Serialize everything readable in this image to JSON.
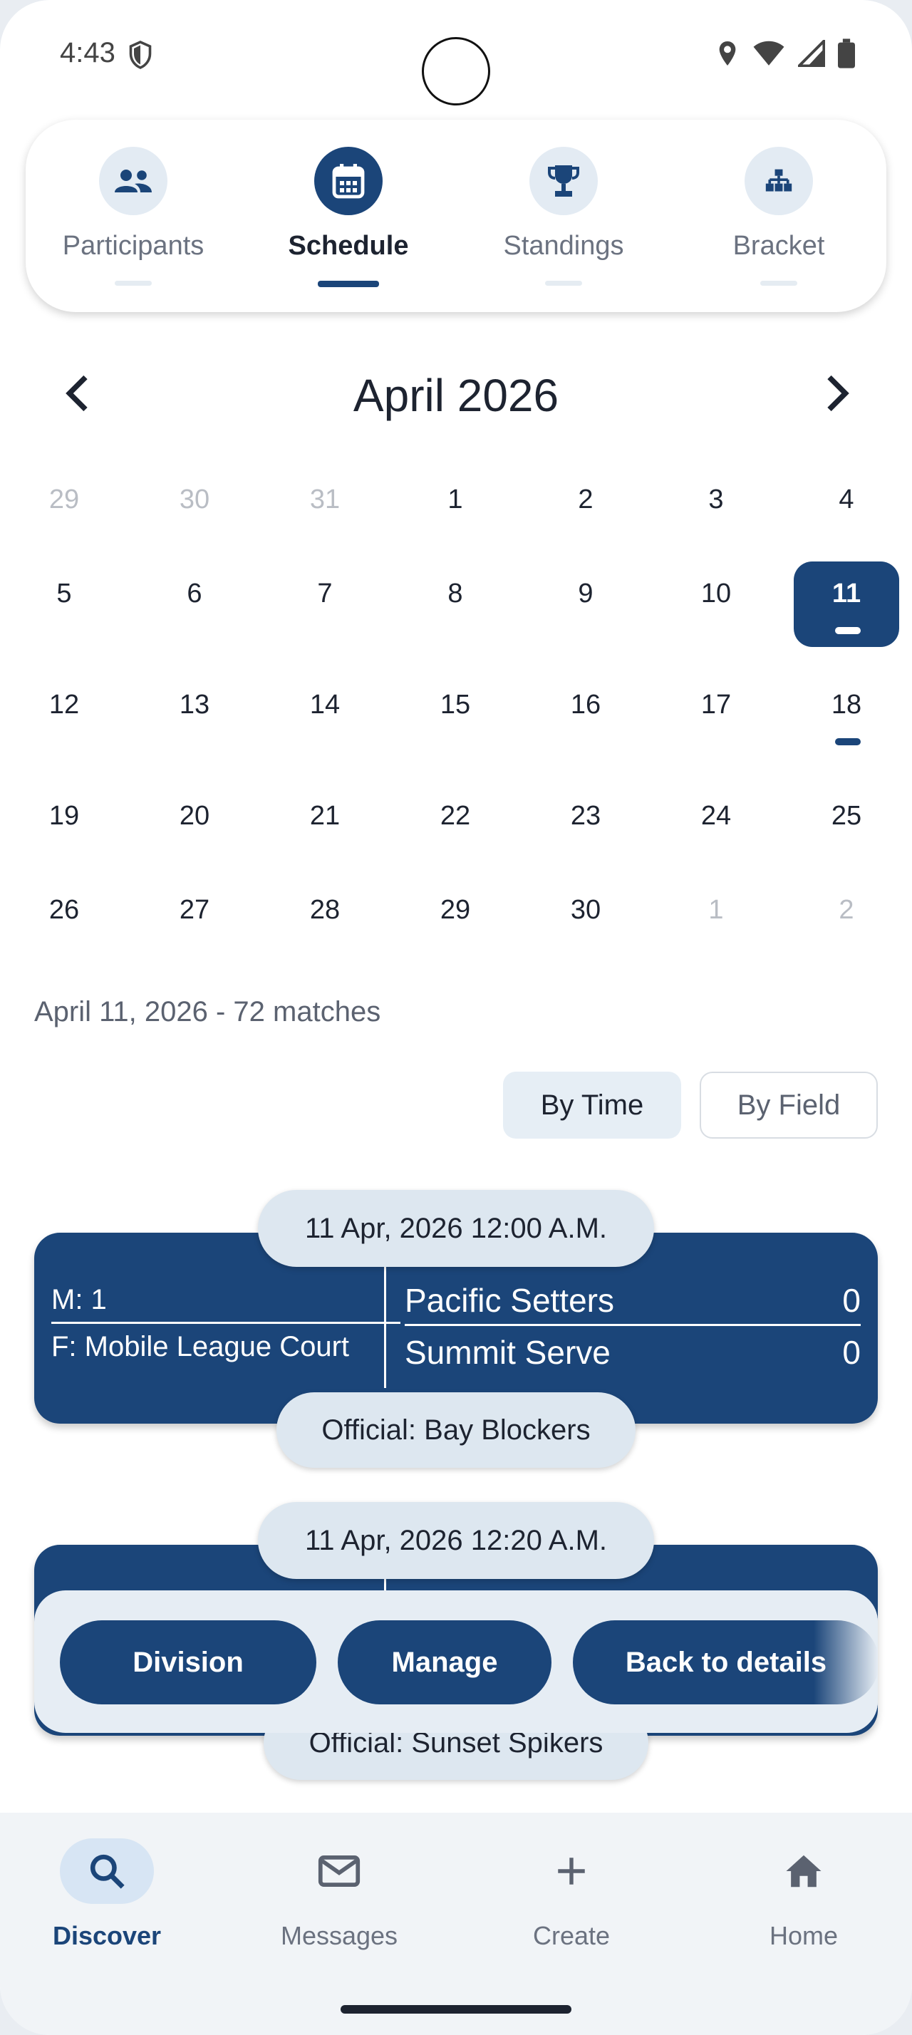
{
  "status_bar": {
    "time": "4:43"
  },
  "tabs": [
    {
      "label": "Participants",
      "icon": "people-icon",
      "active": false
    },
    {
      "label": "Schedule",
      "icon": "calendar-icon",
      "active": true
    },
    {
      "label": "Standings",
      "icon": "trophy-icon",
      "active": false
    },
    {
      "label": "Bracket",
      "icon": "bracket-icon",
      "active": false
    }
  ],
  "calendar": {
    "month_label": "April 2026",
    "selected_day": "11",
    "days": [
      [
        "29",
        "30",
        "31",
        "1",
        "2",
        "3",
        "4"
      ],
      [
        "5",
        "6",
        "7",
        "8",
        "9",
        "10",
        "11"
      ],
      [
        "12",
        "13",
        "14",
        "15",
        "16",
        "17",
        "18"
      ],
      [
        "19",
        "20",
        "21",
        "22",
        "23",
        "24",
        "25"
      ],
      [
        "26",
        "27",
        "28",
        "29",
        "30",
        "1",
        "2"
      ]
    ]
  },
  "summary": "April 11, 2026 - 72 matches",
  "view_toggle": {
    "by_time": "By Time",
    "by_field": "By Field",
    "selected": "By Time"
  },
  "matches": [
    {
      "time": "11 Apr, 2026 12:00 A.M.",
      "match": "M: 1",
      "field": "F: Mobile League Court",
      "team1": "Pacific Setters",
      "score1": "0",
      "team2": "Summit Serve",
      "score2": "0",
      "official": "Official: Bay Blockers"
    },
    {
      "time": "11 Apr, 2026 12:20 A.M.",
      "official": "Official: Sunset Spikers"
    }
  ],
  "actions": {
    "division": "Division",
    "manage": "Manage",
    "back": "Back to details"
  },
  "bottom_nav": [
    {
      "label": "Discover",
      "icon": "search-icon",
      "active": true
    },
    {
      "label": "Messages",
      "icon": "mail-icon",
      "active": false
    },
    {
      "label": "Create",
      "icon": "plus-icon",
      "active": false
    },
    {
      "label": "Home",
      "icon": "home-icon",
      "active": false
    }
  ],
  "colors": {
    "primary": "#1b4579",
    "pill": "#dde7f0",
    "action_bg": "#e6edf4"
  }
}
